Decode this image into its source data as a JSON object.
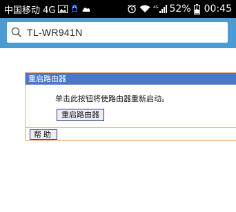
{
  "statusbar": {
    "carrier": "中国移动 4G",
    "signal_label": "4G",
    "battery_percent": "52%",
    "time": "00:45",
    "icons": [
      "image-icon",
      "qq-icon",
      "cloud-icon",
      "alarm-icon",
      "wifi-icon",
      "cell-signal-icon",
      "battery-icon"
    ]
  },
  "browser": {
    "address_text": "TL-WR941N"
  },
  "panel": {
    "title": "重启路由器",
    "message": "单击此按钮将使路由器重新启动。",
    "reboot_button": "重启路由器",
    "help_button": "帮助"
  },
  "colors": {
    "browser_bar": "#4a9ad4",
    "panel_title_bg": "#4a78c3",
    "panel_border": "#e8a872"
  }
}
